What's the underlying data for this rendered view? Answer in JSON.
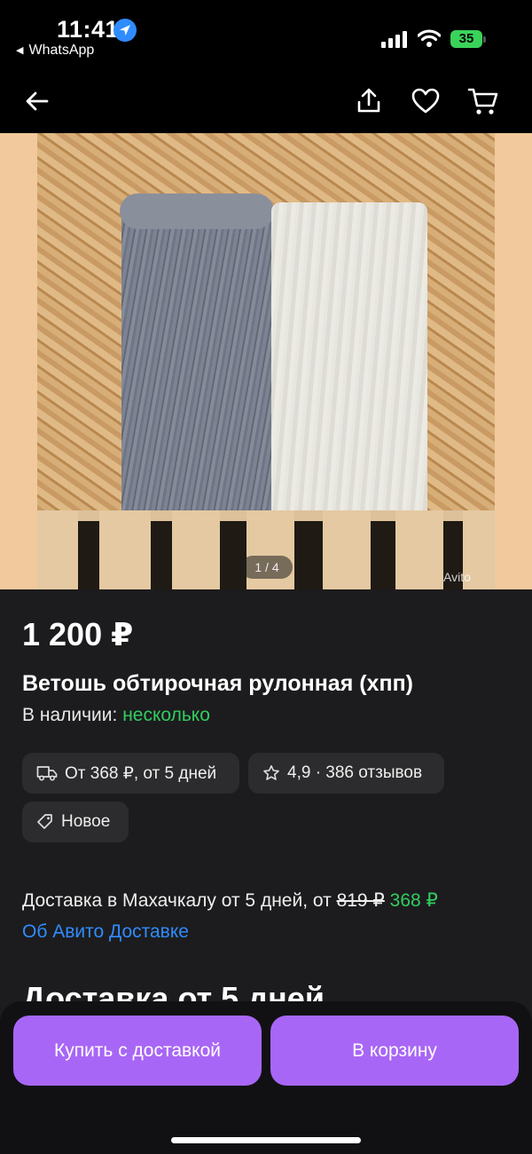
{
  "status_bar": {
    "time": "11:41",
    "back_app": "WhatsApp",
    "battery": "35"
  },
  "nav": {
    "back_icon": "arrow-left-icon",
    "share_icon": "share-icon",
    "favorite_icon": "heart-icon",
    "cart_icon": "cart-icon"
  },
  "gallery": {
    "counter": "1 / 4",
    "watermark": "Avito"
  },
  "listing": {
    "price": "1 200 ₽",
    "title": "Ветошь обтирочная рулонная (хпп)",
    "stock_label": "В наличии:",
    "stock_value": "несколько",
    "chips": {
      "delivery": "От 368 ₽, от 5 дней",
      "rating": "4,9 · 386 отзывов",
      "condition": "Новое"
    },
    "delivery_text": "Доставка в Махачкалу от 5 дней, от",
    "delivery_old_price": "819 ₽",
    "delivery_new_price": "368 ₽",
    "about_delivery_link": "Об Авито Доставке",
    "section_heading": "Доставка от 5 дней"
  },
  "actions": {
    "buy_with_delivery": "Купить с доставкой",
    "add_to_cart": "В корзину"
  },
  "colors": {
    "accent_purple": "#a866f6",
    "green": "#32cd5f",
    "link_blue": "#2f8cff",
    "background": "#1c1c1e"
  }
}
